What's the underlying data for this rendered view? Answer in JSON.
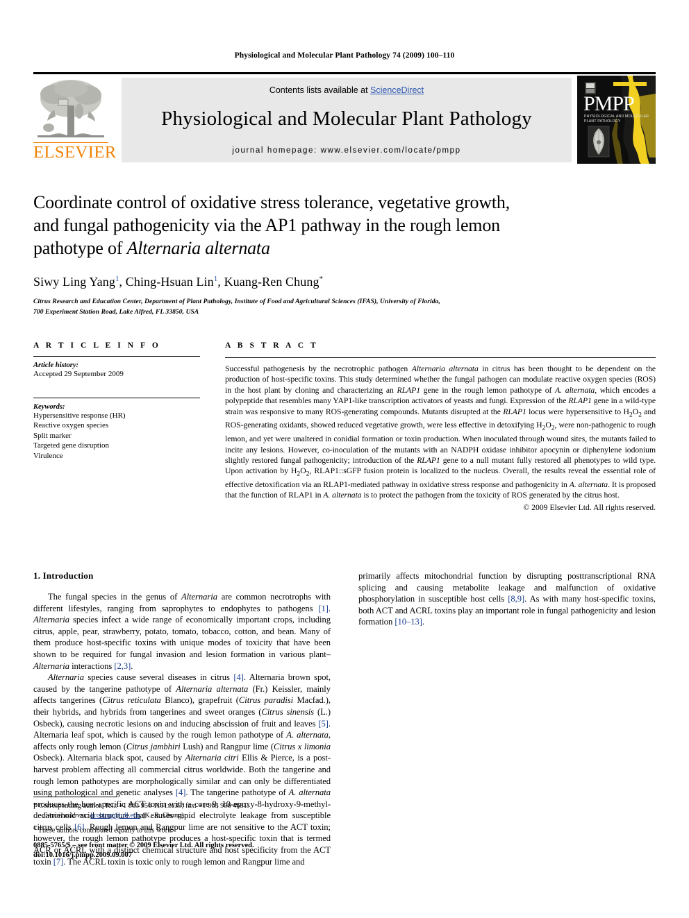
{
  "running_head": "Physiological and Molecular Plant Pathology 74 (2009) 100–110",
  "masthead": {
    "contents_prefix": "Contents lists available at ",
    "sciencedirect": "ScienceDirect",
    "journal_title": "Physiological and Molecular Plant Pathology",
    "homepage": "journal homepage: www.elsevier.com/locate/pmpp",
    "publisher_wordmark": "ELSEVIER",
    "publisher_color": "#F08000",
    "link_color": "#2b56b0",
    "band_color": "#e8e8e8",
    "cover_title": "PMPP",
    "cover_subtitle_line1": "PHYSIOLOGICAL AND MOLECULAR",
    "cover_subtitle_line2": "PLANT PATHOLOGY",
    "cover_bg": "#0d0d0d",
    "cover_accent": "#f2d022"
  },
  "title": {
    "line1": "Coordinate control of oxidative stress tolerance, vegetative growth,",
    "line2": "and fungal pathogenicity via the AP1 pathway in the rough lemon",
    "line3_plain": "pathotype of ",
    "line3_italic": "Alternaria alternata"
  },
  "authors": {
    "a1": "Siwy Ling Yang",
    "a1_mark": "1",
    "sep1": ", ",
    "a2": "Ching-Hsuan Lin",
    "a2_mark": "1",
    "sep2": ", ",
    "a3": "Kuang-Ren Chung",
    "a3_mark": "*"
  },
  "affiliation": {
    "line1": "Citrus Research and Education Center, Department of Plant Pathology, Institute of Food and Agricultural Sciences (IFAS), University of Florida,",
    "line2": "700 Experiment Station Road, Lake Alfred, FL 33850, USA"
  },
  "article_info": {
    "heading": "A R T I C L E  I N F O",
    "history_label": "Article history:",
    "history_value": "Accepted 29 September 2009",
    "keywords_label": "Keywords:",
    "keywords": [
      "Hypersensitive response (HR)",
      "Reactive oxygen species",
      "Split marker",
      "Targeted gene disruption",
      "Virulence"
    ]
  },
  "abstract": {
    "heading": "A B S T R A C T",
    "text_parts": [
      {
        "t": "Successful pathogenesis by the necrotrophic pathogen ",
        "s": "n"
      },
      {
        "t": "Alternaria alternata",
        "s": "i"
      },
      {
        "t": " in citrus has been thought to be dependent on the production of host-specific toxins. This study determined whether the fungal pathogen can modulate reactive oxygen species (ROS) in the host plant by cloning and characterizing an ",
        "s": "n"
      },
      {
        "t": "RLAP1",
        "s": "i"
      },
      {
        "t": " gene in the rough lemon pathotype of ",
        "s": "n"
      },
      {
        "t": "A. alternata",
        "s": "i"
      },
      {
        "t": ", which encodes a polypeptide that resembles many YAP1-like transcription activators of yeasts and fungi. Expression of the ",
        "s": "n"
      },
      {
        "t": "RLAP1",
        "s": "i"
      },
      {
        "t": " gene in a wild-type strain was responsive to many ROS-generating compounds. Mutants disrupted at the ",
        "s": "n"
      },
      {
        "t": "RLAP1",
        "s": "i"
      },
      {
        "t": " locus were hypersensitive to H",
        "s": "n"
      },
      {
        "t": "2",
        "s": "sub"
      },
      {
        "t": "O",
        "s": "n"
      },
      {
        "t": "2",
        "s": "sub"
      },
      {
        "t": " and ROS-generating oxidants, showed reduced vegetative growth, were less effective in detoxifying H",
        "s": "n"
      },
      {
        "t": "2",
        "s": "sub"
      },
      {
        "t": "O",
        "s": "n"
      },
      {
        "t": "2",
        "s": "sub"
      },
      {
        "t": ", were non-pathogenic to rough lemon, and yet were unaltered in conidial formation or toxin production. When inoculated through wound sites, the mutants failed to incite any lesions. However, co-inoculation of the mutants with an NADPH oxidase inhibitor apocynin or diphenylene iodonium slightly restored fungal pathogenicity; introduction of the ",
        "s": "n"
      },
      {
        "t": "RLAP1",
        "s": "i"
      },
      {
        "t": " gene to a null mutant fully restored all phenotypes to wild type. Upon activation by H",
        "s": "n"
      },
      {
        "t": "2",
        "s": "sub"
      },
      {
        "t": "O",
        "s": "n"
      },
      {
        "t": "2",
        "s": "sub"
      },
      {
        "t": ", RLAP1::sGFP fusion protein is localized to the nucleus. Overall, the results reveal the essential role of effective detoxification via an RLAP1-mediated pathway in oxidative stress response and pathogenicity in ",
        "s": "n"
      },
      {
        "t": "A. alternata",
        "s": "i"
      },
      {
        "t": ". It is proposed that the function of RLAP1 in ",
        "s": "n"
      },
      {
        "t": "A. alternata",
        "s": "i"
      },
      {
        "t": " is to protect the pathogen from the toxicity of ROS generated by the citrus host.",
        "s": "n"
      }
    ],
    "copyright": "© 2009 Elsevier Ltd. All rights reserved."
  },
  "introduction": {
    "heading": "1. Introduction",
    "para1_parts": [
      {
        "t": "The fungal species in the genus of ",
        "s": "n"
      },
      {
        "t": "Alternaria",
        "s": "i"
      },
      {
        "t": " are common necrotrophs with different lifestyles, ranging from saprophytes to endophytes to pathogens ",
        "s": "n"
      },
      {
        "t": "[1]",
        "s": "r"
      },
      {
        "t": ". ",
        "s": "n"
      },
      {
        "t": "Alternaria",
        "s": "i"
      },
      {
        "t": " species infect a wide range of economically important crops, including citrus, apple, pear, strawberry, potato, tomato, tobacco, cotton, and bean. Many of them produce host-specific toxins with unique modes of toxicity that have been shown to be required for fungal invasion and lesion formation in various plant–",
        "s": "n"
      },
      {
        "t": "Alternaria",
        "s": "i"
      },
      {
        "t": " interactions ",
        "s": "n"
      },
      {
        "t": "[2,3]",
        "s": "r"
      },
      {
        "t": ".",
        "s": "n"
      }
    ],
    "para2_parts": [
      {
        "t": "Alternaria",
        "s": "i"
      },
      {
        "t": " species cause several diseases in citrus ",
        "s": "n"
      },
      {
        "t": "[4]",
        "s": "r"
      },
      {
        "t": ". Alternaria brown spot, caused by the tangerine pathotype of ",
        "s": "n"
      },
      {
        "t": "Alternaria alternata",
        "s": "i"
      },
      {
        "t": " (Fr.) Keissler, mainly affects tangerines (",
        "s": "n"
      },
      {
        "t": "Citrus reticulata",
        "s": "i"
      },
      {
        "t": " Blanco), grapefruit (",
        "s": "n"
      },
      {
        "t": "Citrus paradisi",
        "s": "i"
      },
      {
        "t": " Macfad.), their hybrids, and hybrids from tangerines and sweet oranges (",
        "s": "n"
      },
      {
        "t": "Citrus sinensis",
        "s": "i"
      },
      {
        "t": " (L.) Osbeck), causing necrotic lesions on and inducing abscission of fruit and leaves ",
        "s": "n"
      },
      {
        "t": "[5]",
        "s": "r"
      },
      {
        "t": ". Alternaria leaf spot, which is caused by the rough lemon pathotype of ",
        "s": "n"
      },
      {
        "t": "A. alternata",
        "s": "i"
      },
      {
        "t": ", affects only rough lemon (",
        "s": "n"
      },
      {
        "t": "Citrus jambhiri",
        "s": "i"
      },
      {
        "t": " Lush) and Rangpur lime (",
        "s": "n"
      },
      {
        "t": "Citrus x limonia",
        "s": "i"
      },
      {
        "t": " Osbeck). Alternaria black spot, caused by ",
        "s": "n"
      },
      {
        "t": "Alternaria citri",
        "s": "i"
      },
      {
        "t": " Ellis & Pierce, is a post-harvest problem affecting all commercial citrus worldwide. Both the tangerine and rough lemon pathotypes are morphologically similar and can only be differentiated using pathological and genetic analyses ",
        "s": "n"
      },
      {
        "t": "[4]",
        "s": "r"
      },
      {
        "t": ". The tangerine pathotype of ",
        "s": "n"
      },
      {
        "t": "A. alternata",
        "s": "i"
      },
      {
        "t": " produces the host-specific ACT toxin with a core 9, 10-epoxy-8-hydroxy-9-methyl-decatrienoic acid structure that causes rapid electrolyte leakage from susceptible citrus cells ",
        "s": "n"
      },
      {
        "t": "[6]",
        "s": "r"
      },
      {
        "t": ". Rough lemon and Rangpur lime are not sensitive to the ACT toxin; however, the rough lemon pathotype produces a host-specific toxin that is termed ACR or ACRL with a distinct chemical structure and host specificity from the ACT toxin ",
        "s": "n"
      },
      {
        "t": "[7]",
        "s": "r"
      },
      {
        "t": ". The ACRL toxin is toxic only to rough lemon and Rangpur lime and primarily affects mitochondrial function by disrupting posttranscriptional RNA splicing and causing metabolite leakage and malfunction of oxidative phosphorylation in susceptible host cells ",
        "s": "n"
      },
      {
        "t": "[8,9]",
        "s": "r"
      },
      {
        "t": ". As with many host-specific toxins, both ACT and ACRL toxins play an important role in fungal pathogenicity and lesion formation ",
        "s": "n"
      },
      {
        "t": "[10–13]",
        "s": "r"
      },
      {
        "t": ".",
        "s": "n"
      }
    ]
  },
  "footnotes": {
    "corresponding_mark": "*",
    "corresponding_text": "Corresponding author. Tel.: +1 863 956 1151x139; fax: +1 863 956 4631.",
    "email_label": "E-mail address:",
    "email": "krchung@ufl.edu",
    "email_suffix": "(K.-R. Chung).",
    "equal_mark": "1",
    "equal_text": "These authors contributed equally to this work."
  },
  "imprint": {
    "line1": "0885-5765/$ – see front matter © 2009 Elsevier Ltd. All rights reserved.",
    "line2": "doi:10.1016/j.pmpp.2009.09.007"
  }
}
